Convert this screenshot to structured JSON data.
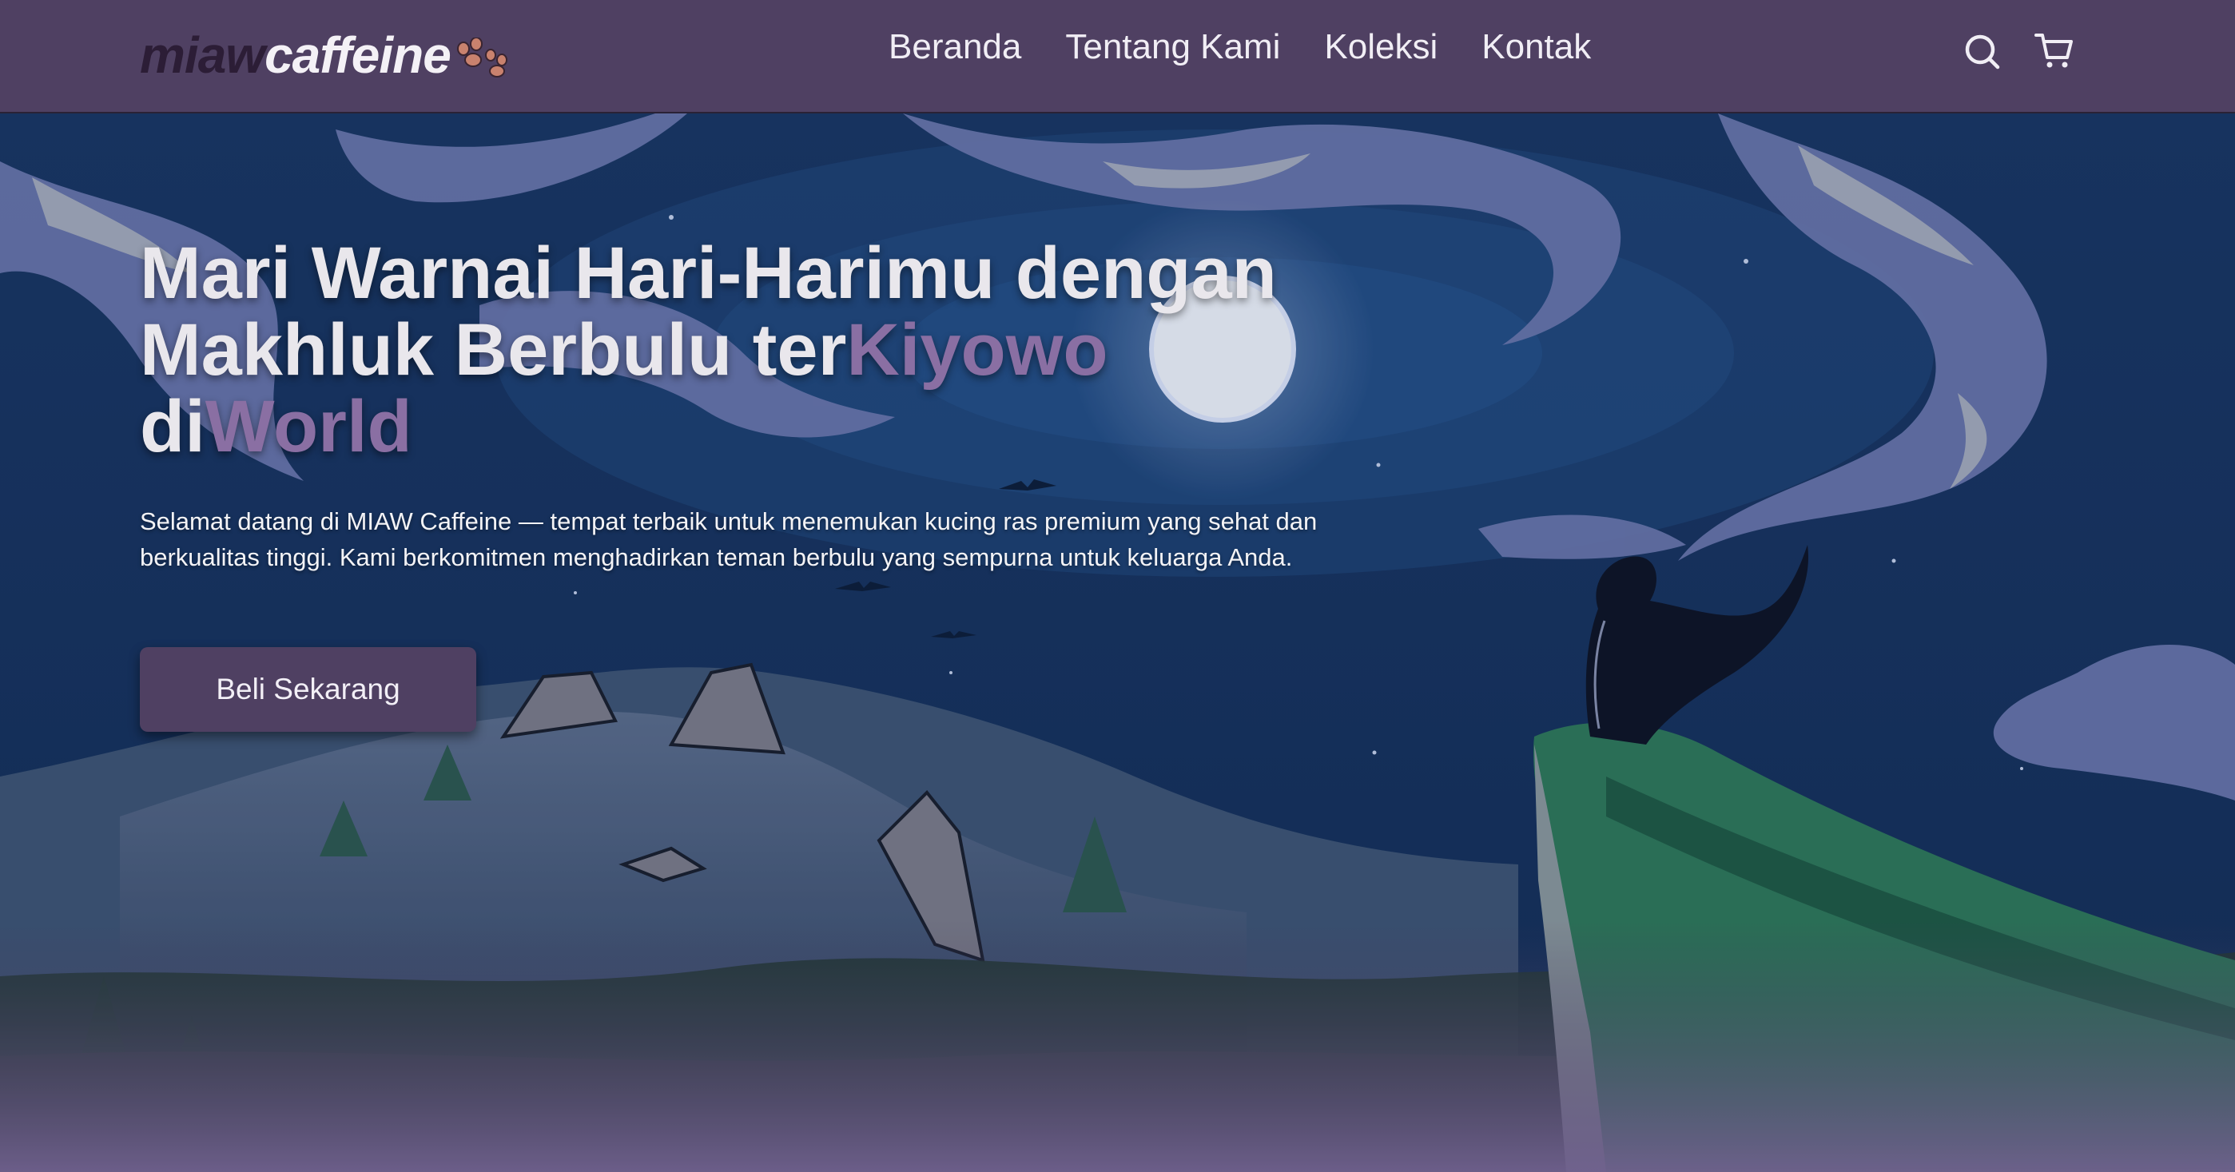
{
  "brand": {
    "name_part1": "miaw",
    "name_part2": "caffeine"
  },
  "nav": {
    "links": [
      "Beranda",
      "Tentang Kami",
      "Koleksi",
      "Kontak"
    ]
  },
  "icons": {
    "search": "search-icon",
    "cart": "cart-icon",
    "logo_mark": "paw-icon"
  },
  "hero": {
    "title_line1": "Mari Warnai Hari-Harimu dengan",
    "title_line2_plain": "Makhluk Berbulu ter",
    "title_line2_accent": "Kiyowo",
    "title_line3_plain": "di",
    "title_line3_accent": "World",
    "subtitle": "Selamat datang di MIAW Caffeine — tempat terbaik untuk menemukan kucing ras premium yang sehat dan berkualitas tinggi. Kami berkomitmen menghadirkan teman berbulu yang sempurna untuk keluarga Anda.",
    "cta_label": "Beli Sekarang"
  },
  "colors": {
    "navbar": "#4f4062",
    "accent": "#8a6fa3",
    "button": "#4f4062",
    "sky": "#1b3a66"
  }
}
